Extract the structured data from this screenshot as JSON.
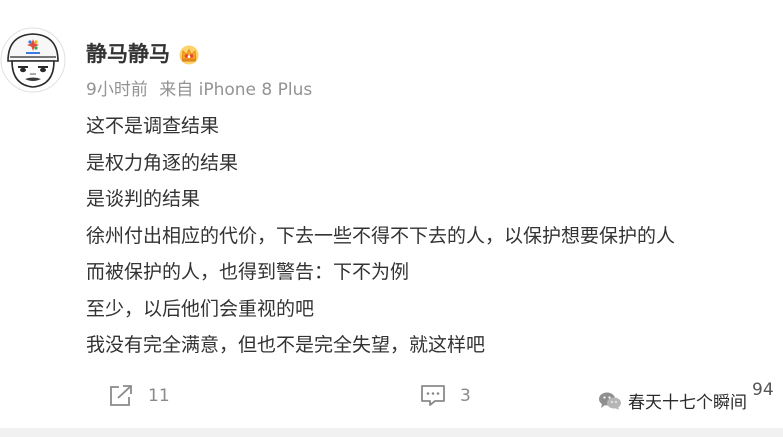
{
  "post": {
    "username": "静马静马",
    "badge_icon": "crown-icon",
    "time": "9小时前",
    "source": "来自 iPhone 8 Plus",
    "lines": [
      "这不是调查结果",
      "是权力角逐的结果",
      "是谈判的结果",
      "徐州付出相应的代价，下去一些不得不下去的人，以保护想要保护的人",
      "而被保护的人，也得到警告：下不为例",
      "至少，以后他们会重视的吧",
      "我没有完全满意，但也不是完全失望，就这样吧"
    ]
  },
  "actions": {
    "share_count": "11",
    "comment_count": "3",
    "like_count": "94"
  },
  "watermark": {
    "text": "春天十七个瞬间"
  }
}
